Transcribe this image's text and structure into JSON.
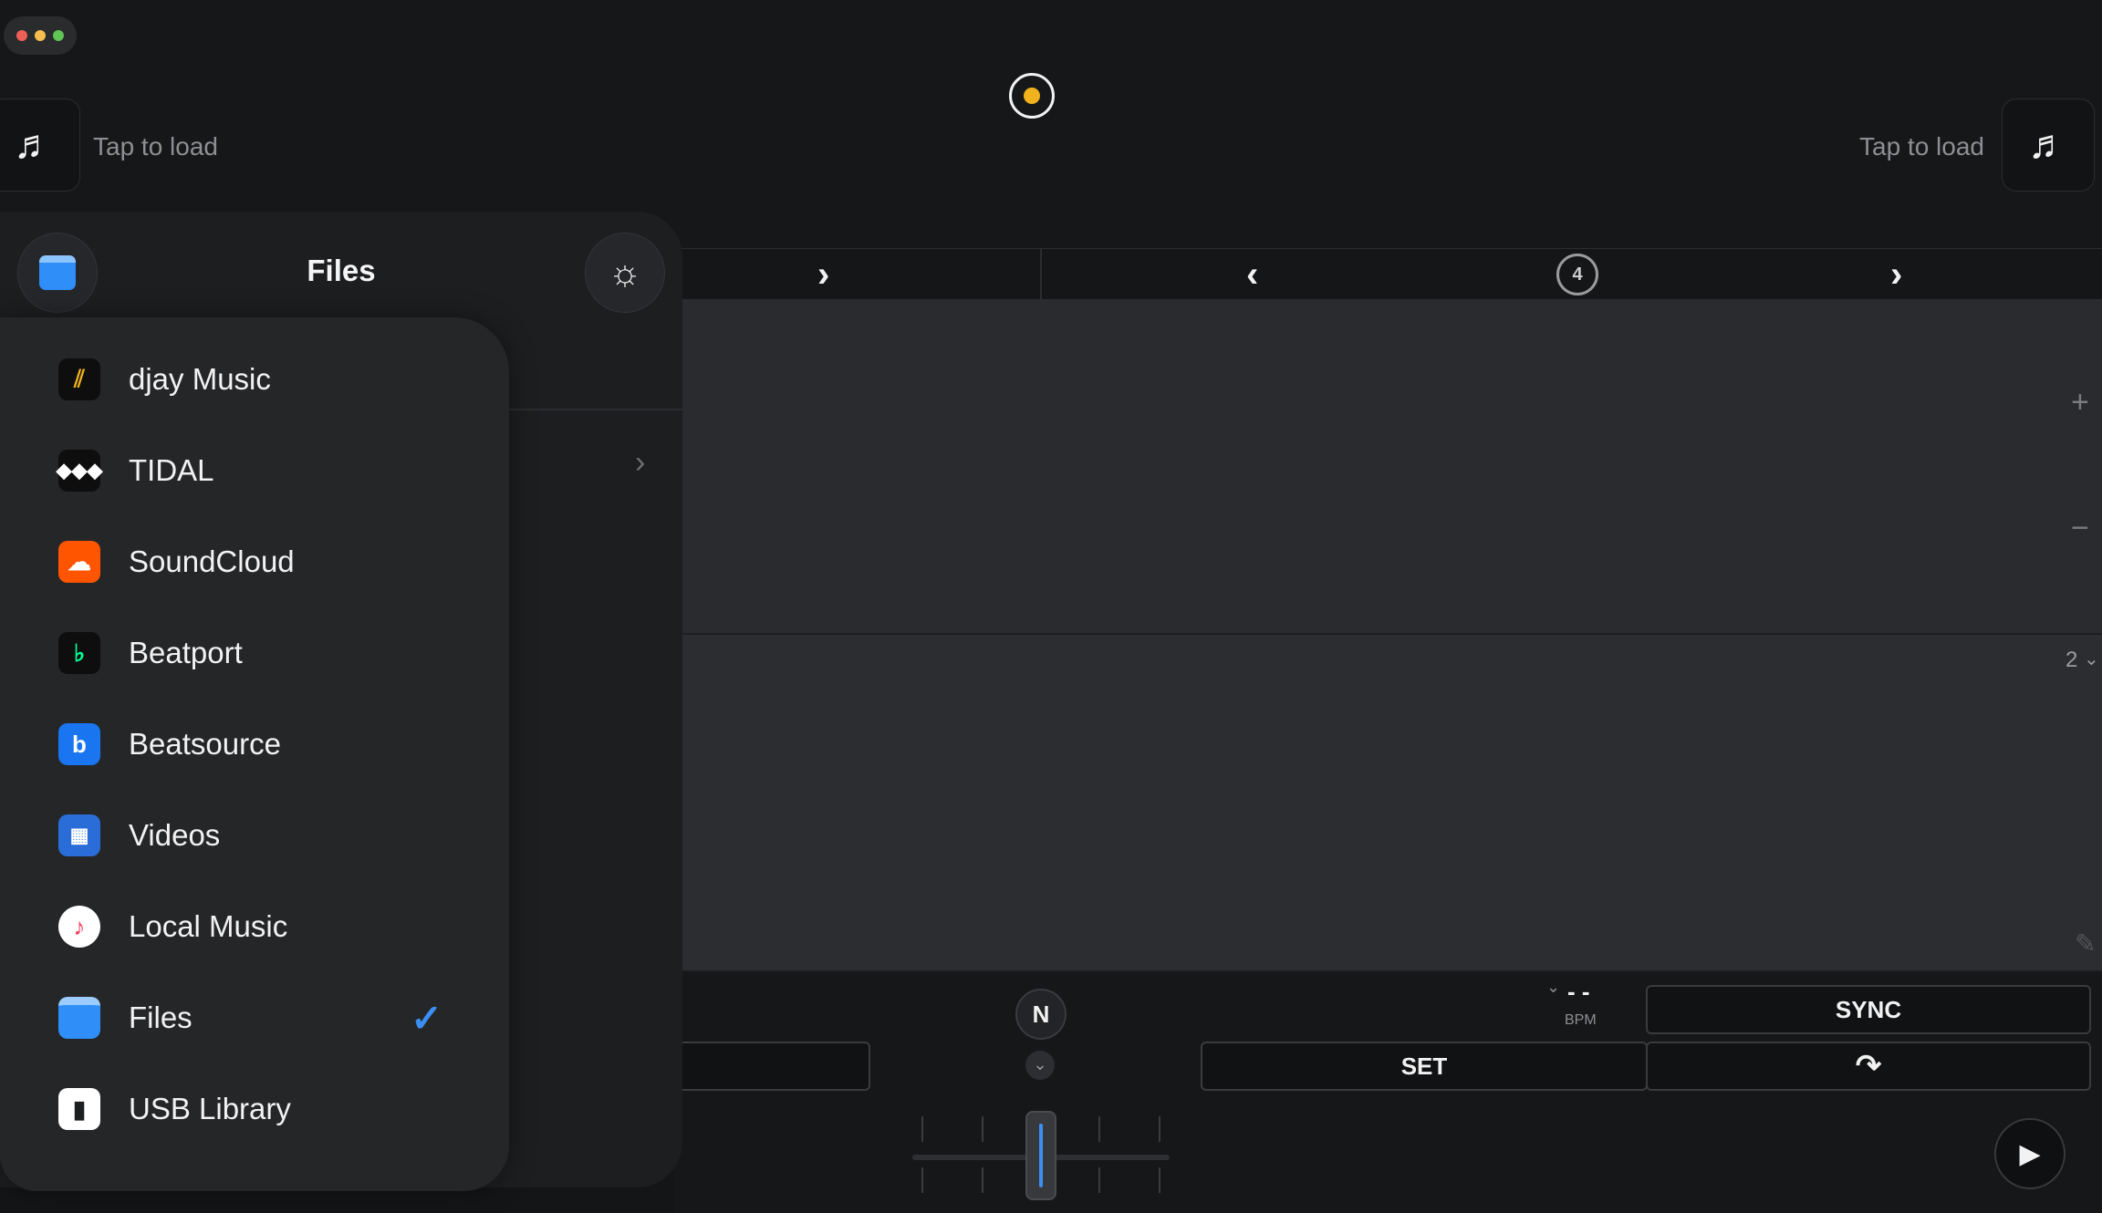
{
  "deck_left": {
    "load_label": "Tap to load",
    "load_icon": "music-note-icon"
  },
  "deck_right": {
    "load_label": "Tap to load",
    "load_icon": "music-note-icon"
  },
  "nav": {
    "loop_count": "4"
  },
  "waveform": {
    "zoom_marks": {
      "plus": "+",
      "minus": "−"
    },
    "beat_jump": "2"
  },
  "controls": {
    "bpm_value": "- -",
    "bpm_label": "BPM",
    "sync_label": "SYNC",
    "set_label": "SET",
    "key_badge": "N"
  },
  "panel": {
    "title": "Files",
    "menu": [
      {
        "label": "djay Music",
        "icon": "djay-music-icon",
        "color": "#0e0e0f"
      },
      {
        "label": "TIDAL",
        "icon": "tidal-icon",
        "color": "#0e0e0f"
      },
      {
        "label": "SoundCloud",
        "icon": "soundcloud-icon",
        "color": "#ff5500"
      },
      {
        "label": "Beatport",
        "icon": "beatport-icon",
        "color": "#0e0e0f"
      },
      {
        "label": "Beatsource",
        "icon": "beatsource-icon",
        "color": "#1976f0"
      },
      {
        "label": "Videos",
        "icon": "film-icon",
        "color": "#2a6cd8"
      },
      {
        "label": "Local Music",
        "icon": "music-app-icon",
        "color": "#ffffff"
      },
      {
        "label": "Files",
        "icon": "folder-icon",
        "color": "#2f8ef7",
        "selected": true
      },
      {
        "label": "USB Library",
        "icon": "usb-drive-icon",
        "color": "#ffffff"
      }
    ]
  },
  "colors": {
    "accent": "#3b8ff0",
    "record_dot": "#f2b21d"
  }
}
